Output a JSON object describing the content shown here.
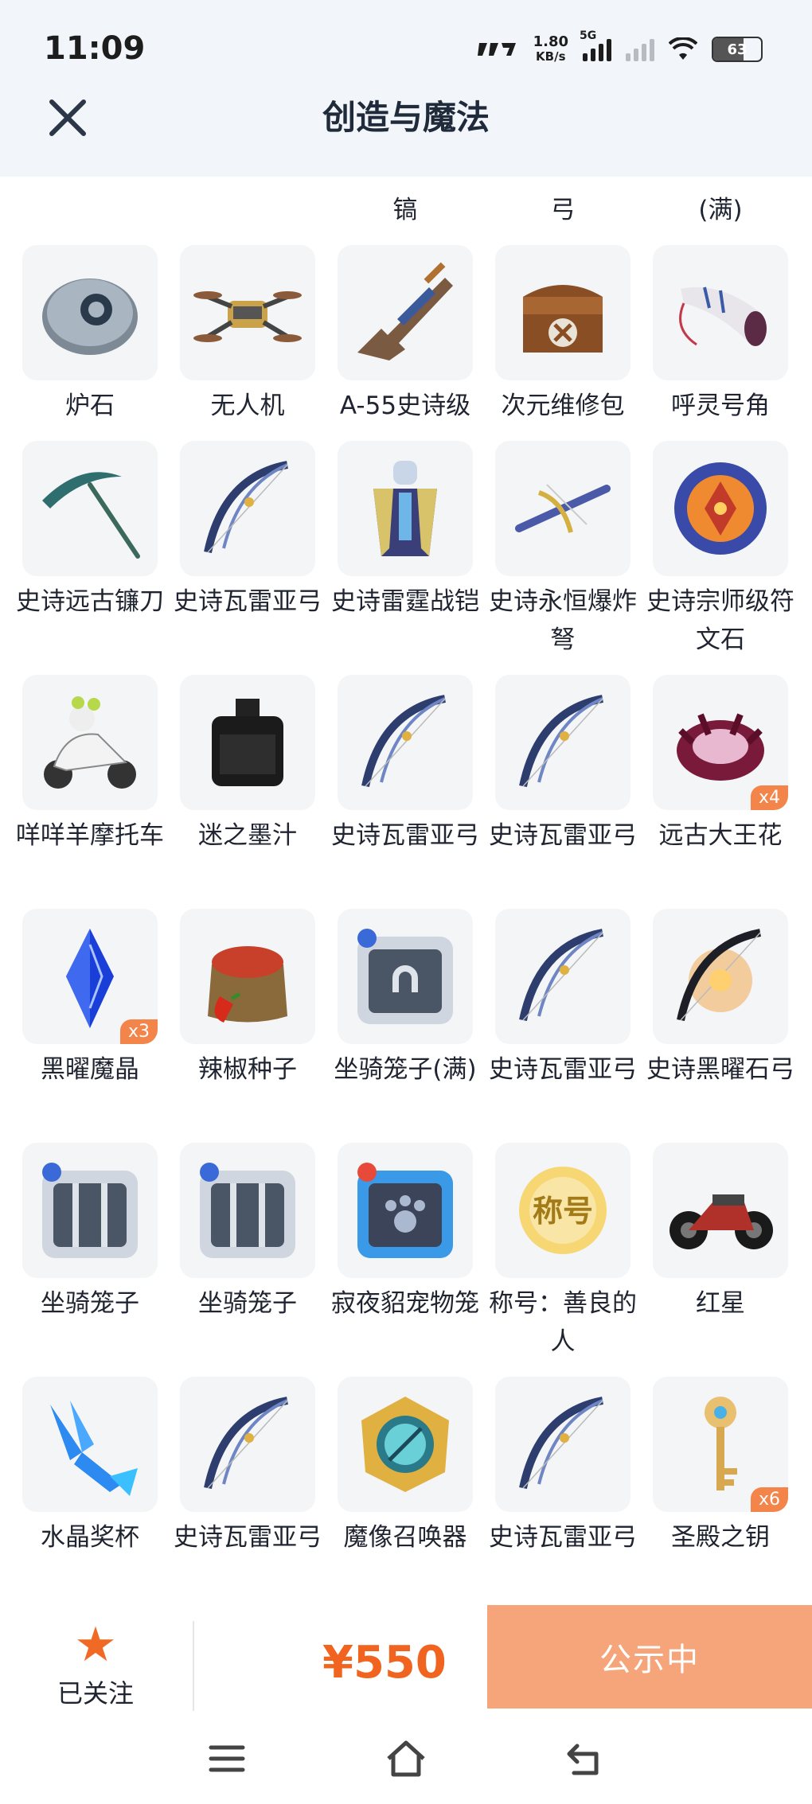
{
  "status_bar": {
    "time": "11:09",
    "net_speed": "1.80",
    "net_unit": "KB/s",
    "network": "5G",
    "battery": "63"
  },
  "header": {
    "title": "创造与魔法"
  },
  "colors": {
    "accent": "#f0641f",
    "action_bg": "#f6a57a",
    "badge": "#f3854b"
  },
  "top_row_partial": [
    "",
    "",
    "镐",
    "弓",
    "(满)"
  ],
  "items": [
    {
      "name": "炉石",
      "icon": "stone-icon"
    },
    {
      "name": "无人机",
      "icon": "drone-icon"
    },
    {
      "name": "A-55史诗级",
      "icon": "rifle-icon"
    },
    {
      "name": "次元维修包",
      "icon": "repair-bag-icon"
    },
    {
      "name": "呼灵号角",
      "icon": "horn-icon"
    },
    {
      "name": "史诗远古镰刀",
      "icon": "scythe-icon"
    },
    {
      "name": "史诗瓦雷亚弓",
      "icon": "bow-icon"
    },
    {
      "name": "史诗雷霆战铠",
      "icon": "armor-icon"
    },
    {
      "name": "史诗永恒爆炸弩",
      "icon": "crossbow-icon"
    },
    {
      "name": "史诗宗师级符文石",
      "icon": "rune-stone-icon"
    },
    {
      "name": "咩咩羊摩托车",
      "icon": "scooter-icon"
    },
    {
      "name": "迷之墨汁",
      "icon": "ink-bottle-icon"
    },
    {
      "name": "史诗瓦雷亚弓",
      "icon": "bow-icon"
    },
    {
      "name": "史诗瓦雷亚弓",
      "icon": "bow-icon"
    },
    {
      "name": "远古大王花",
      "icon": "flower-icon",
      "qty": "x4"
    },
    {
      "name": "黑曜魔晶",
      "icon": "crystal-icon",
      "qty": "x3"
    },
    {
      "name": "辣椒种子",
      "icon": "seed-sack-icon"
    },
    {
      "name": "坐骑笼子(满)",
      "icon": "cage-full-icon"
    },
    {
      "name": "史诗瓦雷亚弓",
      "icon": "bow-icon"
    },
    {
      "name": "史诗黑曜石弓",
      "icon": "obsidian-bow-icon"
    },
    {
      "name": "坐骑笼子",
      "icon": "cage-icon"
    },
    {
      "name": "坐骑笼子",
      "icon": "cage-icon"
    },
    {
      "name": "寂夜貂宠物笼",
      "icon": "pet-cage-icon"
    },
    {
      "name": "称号：善良的人",
      "icon": "title-badge-icon",
      "badge_text": "称号"
    },
    {
      "name": "红星",
      "icon": "motorcycle-icon"
    },
    {
      "name": "水晶奖杯",
      "icon": "trophy-icon"
    },
    {
      "name": "史诗瓦雷亚弓",
      "icon": "bow-icon"
    },
    {
      "name": "魔像召唤器",
      "icon": "summoner-icon"
    },
    {
      "name": "史诗瓦雷亚弓",
      "icon": "bow-icon"
    },
    {
      "name": "圣殿之钥",
      "icon": "key-icon",
      "qty": "x6"
    }
  ],
  "bottom_bar": {
    "follow_label": "已关注",
    "price": "¥550",
    "action_label": "公示中"
  },
  "system_nav": {
    "menu": "menu-icon",
    "home": "home-icon",
    "back": "back-icon"
  }
}
